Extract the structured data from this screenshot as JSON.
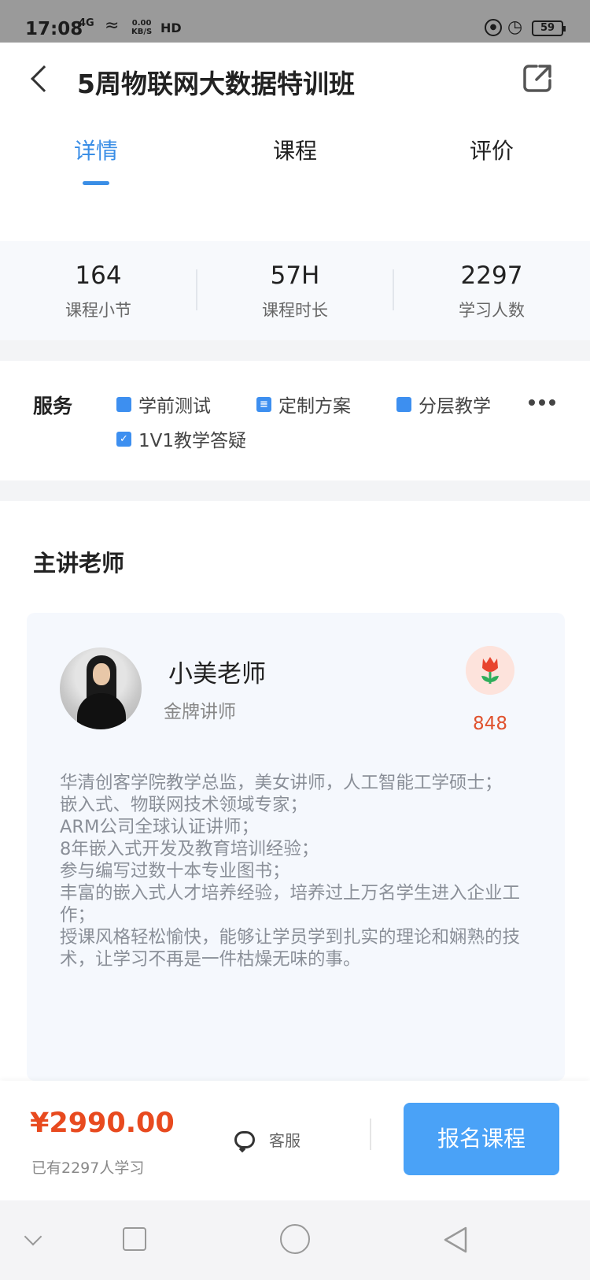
{
  "status_bar": {
    "time": "17:08",
    "signal": "4G",
    "speed_top": "0.00",
    "speed_bottom": "KB/S",
    "hd": "HD",
    "battery": "59"
  },
  "header": {
    "title": "5周物联网大数据特训班"
  },
  "tabs": [
    {
      "label": "详情",
      "active": true
    },
    {
      "label": "课程",
      "active": false
    },
    {
      "label": "评价",
      "active": false
    }
  ],
  "stats": [
    {
      "value": "164",
      "label": "课程小节"
    },
    {
      "value": "57H",
      "label": "课程时长"
    },
    {
      "value": "2297",
      "label": "学习人数"
    }
  ],
  "services": {
    "title": "服务",
    "items": [
      "学前测试",
      "定制方案",
      "分层教学",
      "1V1教学答疑"
    ]
  },
  "teacher_section": {
    "title": "主讲老师",
    "name": "小美老师",
    "role": "金牌讲师",
    "flowers": "848",
    "bio": [
      "华清创客学院教学总监，美女讲师，人工智能工学硕士；",
      "嵌入式、物联网技术领域专家；",
      "ARM公司全球认证讲师；",
      "8年嵌入式开发及教育培训经验；",
      "参与编写过数十本专业图书；",
      "丰富的嵌入式人才培养经验，培养过上万名学生进入企业工作；",
      "授课风格轻松愉快，能够让学员学到扎实的理论和娴熟的技术，让学习不再是一件枯燥无味的事。"
    ]
  },
  "bottom_bar": {
    "price": "¥2990.00",
    "learners": "已有2297人学习",
    "customer_service": "客服",
    "enroll": "报名课程"
  },
  "colors": {
    "accent": "#3a8ee6",
    "price": "#e84a1f",
    "button": "#4aa2f7"
  }
}
